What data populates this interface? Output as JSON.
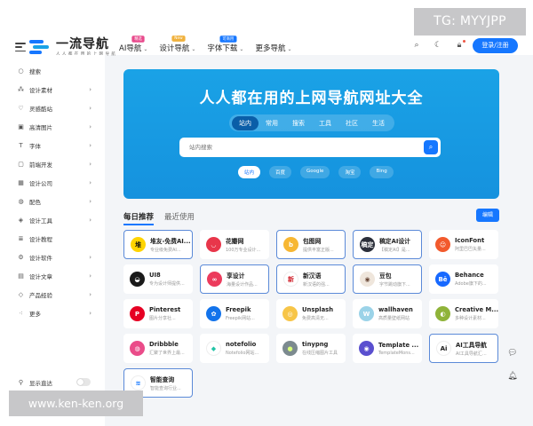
{
  "watermark_top": "TG: MYYJPP",
  "watermark_bottom": "www.ken-ken.org",
  "logo": {
    "main": "一流导航",
    "sub": "人 人 都 在 用 的 上 网 导 航"
  },
  "nav": [
    {
      "label": "AI导航",
      "badge": "精选",
      "badge_color": "#e84a8c"
    },
    {
      "label": "设计导航",
      "badge": "New",
      "badge_color": "#f0b13c"
    },
    {
      "label": "字体下载",
      "badge": "可商用",
      "badge_color": "#1677ff"
    },
    {
      "label": "更多导航",
      "badge": "",
      "badge_color": ""
    }
  ],
  "login_label": "登录/注册",
  "sidebar": [
    {
      "label": "搜索",
      "icon": "○",
      "icon_name": "search-icon",
      "arrow": false
    },
    {
      "label": "设计素材",
      "icon": "⁂",
      "icon_name": "grid-icon",
      "arrow": true
    },
    {
      "label": "灵感酷站",
      "icon": "♡",
      "icon_name": "lightbulb-icon",
      "arrow": true
    },
    {
      "label": "高清图片",
      "icon": "▣",
      "icon_name": "image-icon",
      "arrow": true
    },
    {
      "label": "字体",
      "icon": "T",
      "icon_name": "font-icon",
      "arrow": true
    },
    {
      "label": "前端开发",
      "icon": "▢",
      "icon_name": "code-icon",
      "arrow": true
    },
    {
      "label": "设计公司",
      "icon": "▦",
      "icon_name": "building-icon",
      "arrow": true
    },
    {
      "label": "配色",
      "icon": "◍",
      "icon_name": "palette-icon",
      "arrow": true
    },
    {
      "label": "设计工具",
      "icon": "◈",
      "icon_name": "tool-icon",
      "arrow": true
    },
    {
      "label": "设计教程",
      "icon": "≣",
      "icon_name": "book-icon",
      "arrow": false
    },
    {
      "label": "设计软件",
      "icon": "⚙",
      "icon_name": "software-icon",
      "arrow": true
    },
    {
      "label": "设计文章",
      "icon": "▤",
      "icon_name": "article-icon",
      "arrow": true
    },
    {
      "label": "产品经验",
      "icon": "◇",
      "icon_name": "product-icon",
      "arrow": true
    },
    {
      "label": "更多",
      "icon": "⁖",
      "icon_name": "more-icon",
      "arrow": true
    }
  ],
  "show_direct_label": "显示直达",
  "hero": {
    "title": "人人都在用的上网导航网址大全",
    "tabs": [
      "站内",
      "常用",
      "搜索",
      "工具",
      "社区",
      "生活"
    ],
    "active_tab": 0,
    "search_placeholder": "站内搜索",
    "engines": [
      "站内",
      "百度",
      "Google",
      "淘宝",
      "Bing"
    ],
    "active_engine": 0
  },
  "section_tabs": [
    "每日推荐",
    "最近使用"
  ],
  "edit_label": "编辑",
  "cards": [
    {
      "name": "堆友-免费AI...",
      "desc": "专业级免费AI...",
      "color": "#ffd400",
      "glyph": "堆",
      "glyph_color": "#111",
      "hl": true
    },
    {
      "name": "花瓣网",
      "desc": "100万专业设计...",
      "color": "#e8364a",
      "glyph": "◡",
      "glyph_color": "#fff",
      "hl": false
    },
    {
      "name": "包图网",
      "desc": "提供丰富正版...",
      "color": "#f7b733",
      "glyph": "b",
      "glyph_color": "#fff",
      "hl": true
    },
    {
      "name": "稿定AI设计",
      "desc": "【稿定AI】是...",
      "color": "#2b2f3a",
      "glyph": "稿定",
      "glyph_color": "#fff",
      "hl": true
    },
    {
      "name": "IconFont",
      "desc": "阿里巴巴矢量...",
      "color": "#f25a2d",
      "glyph": "☺",
      "glyph_color": "#fff",
      "hl": false
    },
    {
      "name": "UI8",
      "desc": "专为设计师提供...",
      "color": "#1a1a1a",
      "glyph": "◒",
      "glyph_color": "#fff",
      "hl": false
    },
    {
      "name": "享设计",
      "desc": "海量设计作品...",
      "color": "#ec3b5c",
      "glyph": "∞",
      "glyph_color": "#fff",
      "hl": true
    },
    {
      "name": "新汉语",
      "desc": "新汉语的强...",
      "color": "#ffffff",
      "glyph": "新",
      "glyph_color": "#d0202a",
      "hl": true
    },
    {
      "name": "豆包",
      "desc": "字节跳动旗下...",
      "color": "#efe6dc",
      "glyph": "◉",
      "glyph_color": "#6b4a3a",
      "hl": true
    },
    {
      "name": "Behance",
      "desc": "Adobe旗下的...",
      "color": "#1769ff",
      "glyph": "Bē",
      "glyph_color": "#fff",
      "hl": false
    },
    {
      "name": "Pinterest",
      "desc": "图片分享社...",
      "color": "#e60023",
      "glyph": "P",
      "glyph_color": "#fff",
      "hl": false
    },
    {
      "name": "Freepik",
      "desc": "Freepik网站...",
      "color": "#1273eb",
      "glyph": "✿",
      "glyph_color": "#fff",
      "hl": false
    },
    {
      "name": "Unsplash",
      "desc": "免费高清无...",
      "color": "#f7c548",
      "glyph": "◎",
      "glyph_color": "#fff",
      "hl": false
    },
    {
      "name": "wallhaven",
      "desc": "高质量壁纸网站",
      "color": "#9bd3e8",
      "glyph": "W",
      "glyph_color": "#fff",
      "hl": false
    },
    {
      "name": "Creative M...",
      "desc": "多种设计素材...",
      "color": "#8fb339",
      "glyph": "◐",
      "glyph_color": "#fff",
      "hl": false
    },
    {
      "name": "Dribbble",
      "desc": "汇聚了世界上最...",
      "color": "#ea4c89",
      "glyph": "◍",
      "glyph_color": "#fff",
      "hl": false
    },
    {
      "name": "notefolio",
      "desc": "Notefolio网站...",
      "color": "#ffffff",
      "glyph": "◆",
      "glyph_color": "#22c3a6",
      "hl": false
    },
    {
      "name": "tinypng",
      "desc": "在线压缩图片工具",
      "color": "#7c8a8f",
      "glyph": "●",
      "glyph_color": "#d8ff7a",
      "hl": false
    },
    {
      "name": "Template ...",
      "desc": "TemplateMons...",
      "color": "#5a4fcf",
      "glyph": "◉",
      "glyph_color": "#fff",
      "hl": false
    },
    {
      "name": "AI工具导航",
      "desc": "AI工具导航汇...",
      "color": "#ffffff",
      "glyph": "Ai",
      "glyph_color": "#1a1a1a",
      "hl": true
    },
    {
      "name": "智能查询",
      "desc": "智能查询行业...",
      "color": "#ffffff",
      "glyph": "≋",
      "glyph_color": "#1677ff",
      "hl": true
    }
  ]
}
